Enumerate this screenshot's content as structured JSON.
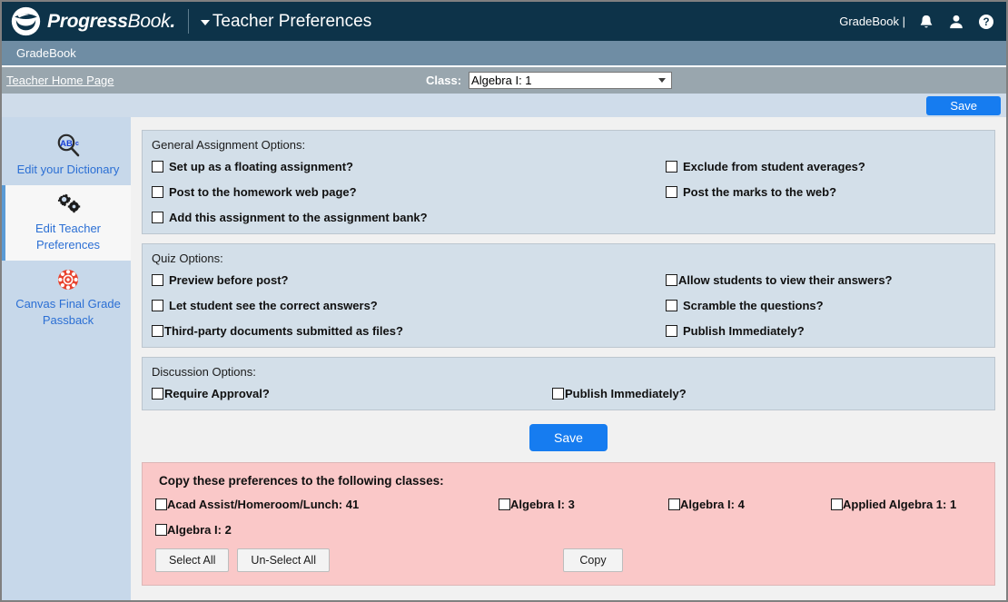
{
  "topbar": {
    "brand_primary": "Progress",
    "brand_secondary": "Book",
    "brand_dot": ".",
    "page_title": "Teacher Preferences",
    "user_label": "GradeBook |",
    "icons": [
      "bell-icon",
      "user-icon",
      "help-icon"
    ]
  },
  "appbar": {
    "label": "GradeBook"
  },
  "crumbbar": {
    "home_link": "Teacher Home Page",
    "class_label": "Class:",
    "class_value": "Algebra I: 1",
    "class_options": [
      "Algebra I: 1",
      "Algebra I: 2",
      "Algebra I: 3",
      "Algebra I: 4",
      "Applied Algebra 1: 1",
      "Acad Assist/Homeroom/Lunch: 41"
    ]
  },
  "toolbar": {
    "save_label": "Save"
  },
  "sidebar": {
    "items": [
      {
        "label": "Edit your Dictionary",
        "icon": "dictionary-icon",
        "selected": false
      },
      {
        "label": "Edit Teacher Preferences",
        "icon": "gears-icon",
        "selected": true
      },
      {
        "label": "Canvas Final Grade Passback",
        "icon": "canvas-icon",
        "selected": false
      }
    ]
  },
  "sections": [
    {
      "title": "General Assignment Options:",
      "options": [
        {
          "label": "Set up as a floating assignment?",
          "checked": false,
          "tight": false
        },
        {
          "label": "Exclude from student averages?",
          "checked": false,
          "tight": false
        },
        {
          "label": "Post to the homework web page?",
          "checked": false,
          "tight": false
        },
        {
          "label": "Post the marks to the web?",
          "checked": false,
          "tight": false
        },
        {
          "label": "Add this assignment to the assignment bank?",
          "checked": false,
          "tight": false
        },
        {
          "label": "",
          "checked": false,
          "tight": false
        }
      ]
    },
    {
      "title": "Quiz Options:",
      "options": [
        {
          "label": "Preview before post?",
          "checked": false,
          "tight": false
        },
        {
          "label": "Allow students to view their answers?",
          "checked": false,
          "tight": true
        },
        {
          "label": "Let student see the correct answers?",
          "checked": false,
          "tight": false
        },
        {
          "label": "Scramble the questions?",
          "checked": false,
          "tight": false
        },
        {
          "label": "Third-party documents submitted as files?",
          "checked": false,
          "tight": true
        },
        {
          "label": "Publish Immediately?",
          "checked": false,
          "tight": false
        }
      ]
    },
    {
      "title": "Discussion Options:",
      "options": [
        {
          "label": "Require Approval?",
          "checked": false,
          "tight": true
        },
        {
          "label": "Publish Immediately?",
          "checked": false,
          "tight": true
        }
      ]
    }
  ],
  "main_save": {
    "label": "Save"
  },
  "copy_panel": {
    "title": "Copy these preferences to the following classes:",
    "classes": [
      {
        "label": "Acad Assist/Homeroom/Lunch: 41",
        "checked": false
      },
      {
        "label": "Algebra I: 3",
        "checked": false
      },
      {
        "label": "Algebra I: 4",
        "checked": false
      },
      {
        "label": "Applied Algebra 1: 1",
        "checked": false
      },
      {
        "label": "Algebra I: 2",
        "checked": false
      }
    ],
    "select_all_label": "Select All",
    "unselect_all_label": "Un-Select All",
    "copy_label": "Copy"
  },
  "colors": {
    "header_navy": "#0d3349",
    "appbar_blue": "#6f8da4",
    "crumb_grey": "#99a6ae",
    "toolbar_blue": "#cfdcea",
    "sidebar_blue": "#c7d8ea",
    "panel_blue": "#d3dfe9",
    "copy_pink": "#fac8c8",
    "accent_blue": "#167cf0",
    "link_blue": "#2b6fd4",
    "canvas_red": "#e8432f"
  }
}
